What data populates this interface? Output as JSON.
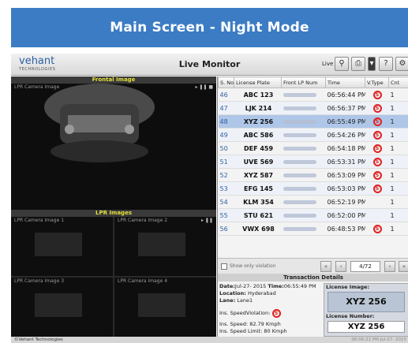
{
  "banner": {
    "title": "Main Screen - Night Mode"
  },
  "app": {
    "logo": "vehant",
    "logo_sub": "TECHNOLOGIES",
    "title": "Live Monitor",
    "live_label": "Live",
    "icons": [
      "search-icon",
      "print-icon",
      "menu-icon",
      "help-icon",
      "settings-icon"
    ]
  },
  "frontal": {
    "section_title": "Frontal Image",
    "camera_label": "LPR Camera Image"
  },
  "lpr": {
    "section_title": "LPR Images",
    "cameras": [
      "LPR Camera Image 1",
      "LPR Camera Image 2",
      "LPR Camera Image 3",
      "LPR Camera Image 4"
    ]
  },
  "table": {
    "columns": [
      "S. No",
      "License Plate",
      "Front LP Num",
      "Time",
      "V.Type",
      "Cnt"
    ],
    "rows": [
      {
        "sno": "46",
        "plate": "ABC 123",
        "time": "06:56:44 PM",
        "violation": true,
        "count": "1"
      },
      {
        "sno": "47",
        "plate": "LJK 214",
        "time": "06:56:37 PM",
        "violation": true,
        "count": "1"
      },
      {
        "sno": "48",
        "plate": "XYZ 256",
        "time": "06:55:49 PM",
        "violation": true,
        "count": "1"
      },
      {
        "sno": "49",
        "plate": "ABC 586",
        "time": "06:54:26 PM",
        "violation": true,
        "count": "1"
      },
      {
        "sno": "50",
        "plate": "DEF 459",
        "time": "06:54:18 PM",
        "violation": true,
        "count": "1"
      },
      {
        "sno": "51",
        "plate": "UVE 569",
        "time": "06:53:31 PM",
        "violation": true,
        "count": "1"
      },
      {
        "sno": "52",
        "plate": "XYZ 587",
        "time": "06:53:09 PM",
        "violation": true,
        "count": "1"
      },
      {
        "sno": "53",
        "plate": "EFG 145",
        "time": "06:53:03 PM",
        "violation": true,
        "count": "1"
      },
      {
        "sno": "54",
        "plate": "KLM 354",
        "time": "06:52:19 PM",
        "violation": false,
        "count": "1"
      },
      {
        "sno": "55",
        "plate": "STU 621",
        "time": "06:52:00 PM",
        "violation": false,
        "count": "1"
      },
      {
        "sno": "56",
        "plate": "VWX 698",
        "time": "06:48:53 PM",
        "violation": true,
        "count": "1"
      }
    ],
    "selected_row": 2
  },
  "pager": {
    "checkbox_label": "Show only violation",
    "page": "4/72"
  },
  "transaction": {
    "header": "Transaction Details",
    "date_label": "Date:",
    "date_value": "Jul-27- 2015",
    "time_label": "Time:",
    "time_value": "06:55:49 PM",
    "location_label": "Location:",
    "location_value": "Hyderabad",
    "lane_label": "Lane:",
    "lane_value": "Lane1",
    "violation_label": "Ins. SpeedViolation:",
    "speed_label": "Ins. Speed:",
    "speed_value": "82.79 Kmph",
    "limit_label": "Ins. Speed Limit:",
    "limit_value": "80 Kmph",
    "license_image_label": "License Image:",
    "license_image_text": "XYZ 256",
    "license_number_label": "License Number:",
    "license_number": "XYZ 256"
  },
  "status": {
    "copyright": "©Vehant Technologies",
    "clock": "06:06:21 PM   Jul-27- 2015"
  },
  "colors": {
    "banner": "#3b7cc4",
    "violation": "#e02020",
    "selected_row": "#aec6e8",
    "section_title": "#e3e03a"
  }
}
